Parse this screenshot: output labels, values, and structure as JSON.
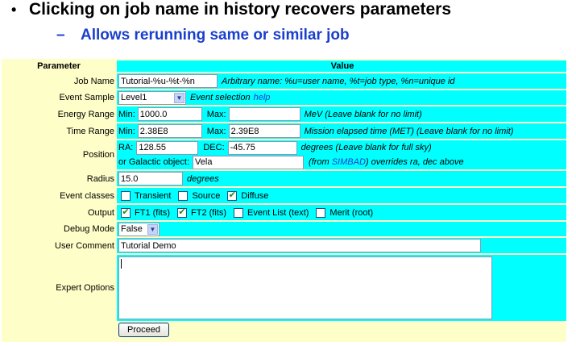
{
  "slide": {
    "bullet_marker": "•",
    "bullet": "Clicking on job name in history recovers parameters",
    "sub_marker": "–",
    "sub_bullet": "Allows rerunning same or similar job"
  },
  "form": {
    "header": {
      "parameter": "Parameter",
      "value": "Value"
    },
    "job_name": {
      "label": "Job Name",
      "value": "Tutorial-%u-%t-%n",
      "note": "Arbitrary name: %u=user name, %t=job type, %n=unique id"
    },
    "event_sample": {
      "label": "Event Sample",
      "selected": "Level1",
      "note": "Event selection",
      "help": "help"
    },
    "energy_range": {
      "label": "Energy Range",
      "min_label": "Min:",
      "min": "1000.0",
      "max_label": "Max:",
      "max": "",
      "note": "MeV (Leave blank for no limit)"
    },
    "time_range": {
      "label": "Time Range",
      "min_label": "Min:",
      "min": "2.38E8",
      "max_label": "Max:",
      "max": "2.39E8",
      "note": "Mission elapsed time (MET) (Leave blank for no limit)"
    },
    "position": {
      "label": "Position",
      "ra_label": "RA:",
      "ra": "128.55",
      "dec_label": "DEC:",
      "dec": "-45.75",
      "note": "degrees (Leave blank for full sky)",
      "galactic_label": "or Galactic object:",
      "galactic": "Vela",
      "simbad_pre": "(from",
      "simbad": "SIMBAD",
      "simbad_post": ") overrides ra, dec above"
    },
    "radius": {
      "label": "Radius",
      "value": "15.0",
      "note": "degrees"
    },
    "event_classes": {
      "label": "Event classes",
      "options": [
        {
          "name": "Transient",
          "checked": false
        },
        {
          "name": "Source",
          "checked": false
        },
        {
          "name": "Diffuse",
          "checked": true
        }
      ]
    },
    "output": {
      "label": "Output",
      "options": [
        {
          "name": "FT1 (fits)",
          "checked": true
        },
        {
          "name": "FT2 (fits)",
          "checked": true
        },
        {
          "name": "Event List (text)",
          "checked": false
        },
        {
          "name": "Merit (root)",
          "checked": false
        }
      ]
    },
    "debug_mode": {
      "label": "Debug Mode",
      "selected": "False"
    },
    "user_comment": {
      "label": "User Comment",
      "value": "Tutorial Demo"
    },
    "expert_options": {
      "label": "Expert Options",
      "value": ""
    },
    "proceed": "Proceed",
    "check_glyph": "✔",
    "dropdown_glyph": "▼"
  }
}
